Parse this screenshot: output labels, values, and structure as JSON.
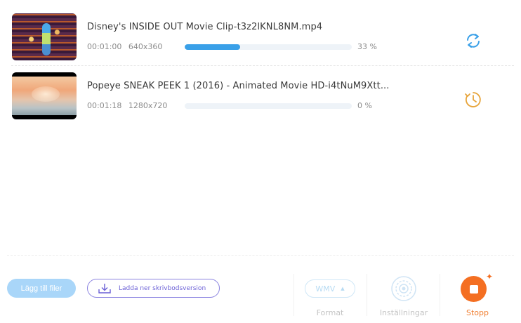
{
  "downloads": [
    {
      "title": "Disney's INSIDE OUT Movie Clip-t3z2lKNL8NM.mp4",
      "duration": "00:01:00",
      "resolution": "640x360",
      "progress_text": "33 %",
      "progress": 0.33,
      "status_icon": "converting-refresh-icon"
    },
    {
      "title": "Popeye SNEAK PEEK 1 (2016) - Animated Movie HD-i4tNuM9Xtt...",
      "duration": "00:01:18",
      "resolution": "1280x720",
      "progress_text": "0 %",
      "progress": 0,
      "status_icon": "pending-clock-icon"
    }
  ],
  "footer": {
    "paste_button": "Lägg till filer",
    "download_desktop_button": "Ladda ner skrivbodsversion",
    "format_value": "WMV",
    "format_label": "Format",
    "settings_label": "Inställningar",
    "stop_label": "Stopp"
  },
  "colors": {
    "accent_blue": "#3aa0e8",
    "accent_orange": "#f46f22",
    "accent_purple": "#6a5fd6"
  }
}
